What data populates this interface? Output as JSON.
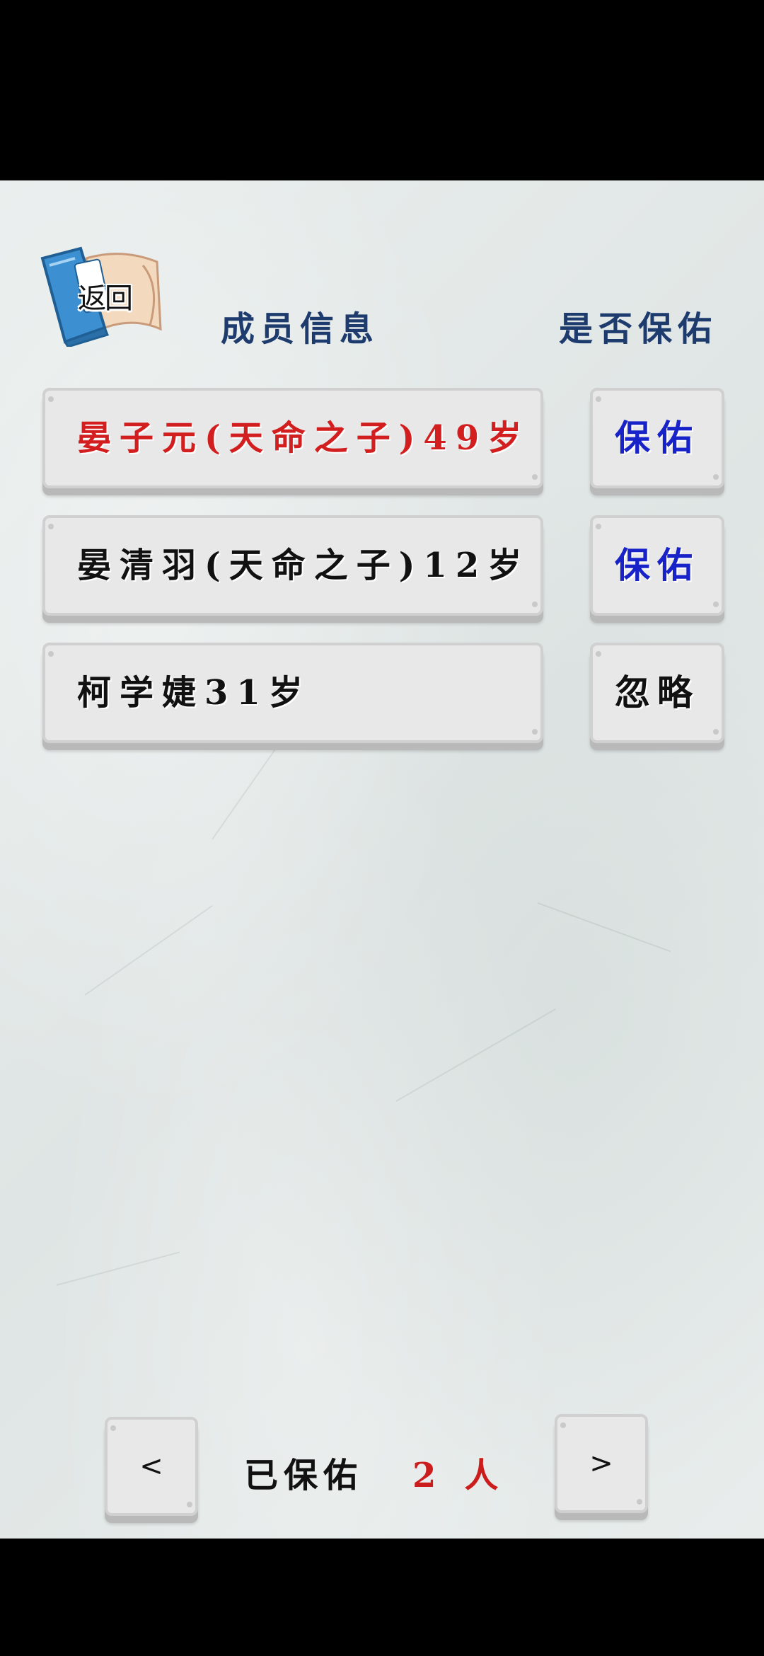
{
  "back_button": {
    "label": "返回"
  },
  "headers": {
    "member_info": "成员信息",
    "protect_question": "是否保佑"
  },
  "members": [
    {
      "name": "晏子元(天命之子)49岁",
      "name_color": "#d21e1e",
      "action": "保佑",
      "action_color": "#1722c8"
    },
    {
      "name": "晏清羽(天命之子)12岁",
      "name_color": "#111111",
      "action": "保佑",
      "action_color": "#1722c8"
    },
    {
      "name": "柯学婕31岁",
      "name_color": "#111111",
      "action": "忽略",
      "action_color": "#111111"
    }
  ],
  "pager": {
    "prev_label": "<",
    "next_label": ">"
  },
  "status": {
    "label": "已保佑",
    "count": "2",
    "unit": "人"
  },
  "colors": {
    "header": "#1e3b6e",
    "highlight_red": "#cc1d1d",
    "protect_blue": "#1722c8"
  }
}
